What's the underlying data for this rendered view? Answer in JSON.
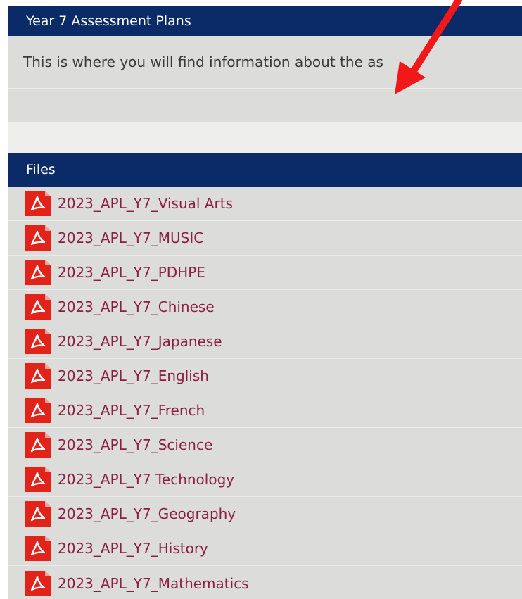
{
  "section": {
    "title": "Year 7 Assessment Plans",
    "description": "This is where you will find information about the as"
  },
  "files": {
    "heading": "Files",
    "icon": "pdf-icon",
    "items": [
      {
        "label": "2023_APL_Y7_Visual Arts"
      },
      {
        "label": "2023_APL_Y7_MUSIC"
      },
      {
        "label": "2023_APL_Y7_PDHPE"
      },
      {
        "label": "2023_APL_Y7_Chinese"
      },
      {
        "label": "2023_APL_Y7_Japanese"
      },
      {
        "label": "2023_APL_Y7_English"
      },
      {
        "label": "2023_APL_Y7_French"
      },
      {
        "label": "2023_APL_Y7_Science"
      },
      {
        "label": "2023_APL_Y7 Technology"
      },
      {
        "label": "2023_APL_Y7_Geography"
      },
      {
        "label": "2023_APL_Y7_History"
      },
      {
        "label": "2023_APL_Y7_Mathematics"
      }
    ]
  },
  "annotation": {
    "icon": "red-arrow-icon",
    "color": "#f01818"
  },
  "colors": {
    "header_bar": "#0b2a68",
    "panel": "#dcdcdb",
    "link": "#8b1e3f",
    "pdf_icon": "#e2231a"
  }
}
